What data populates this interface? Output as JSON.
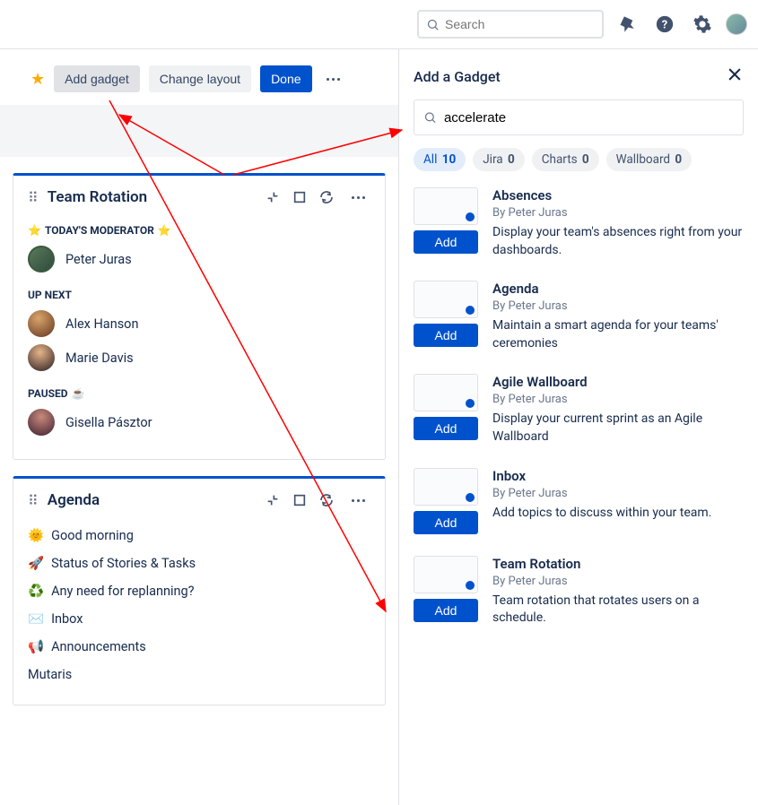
{
  "topbar": {
    "search_placeholder": "Search"
  },
  "toolbar": {
    "add_gadget": "Add gadget",
    "change_layout": "Change layout",
    "done": "Done"
  },
  "card_rotation": {
    "title": "Team Rotation",
    "today_label": "TODAY'S MODERATOR",
    "moderator": "Peter Juras",
    "up_next_label": "UP NEXT",
    "up_next": [
      "Alex Hanson",
      "Marie Davis"
    ],
    "paused_label": "PAUSED",
    "paused": [
      "Gisella Pásztor"
    ]
  },
  "card_agenda": {
    "title": "Agenda",
    "items": [
      {
        "emoji": "🌞",
        "text": "Good morning"
      },
      {
        "emoji": "🚀",
        "text": "Status of Stories & Tasks"
      },
      {
        "emoji": "♻️",
        "text": "Any need for replanning?"
      },
      {
        "emoji": "✉️",
        "text": "Inbox"
      },
      {
        "emoji": "📢",
        "text": "Announcements"
      },
      {
        "emoji": "",
        "text": "Mutaris"
      }
    ]
  },
  "panel": {
    "title": "Add a Gadget",
    "search_value": "accelerate",
    "tabs": [
      {
        "label": "All",
        "count": "10"
      },
      {
        "label": "Jira",
        "count": "0"
      },
      {
        "label": "Charts",
        "count": "0"
      },
      {
        "label": "Wallboard",
        "count": "0"
      }
    ],
    "add_label": "Add",
    "gadgets": [
      {
        "title": "Absences",
        "author": "By Peter Juras",
        "desc": "Display your team's absences right from your dashboards."
      },
      {
        "title": "Agenda",
        "author": "By Peter Juras",
        "desc": "Maintain a smart agenda for your teams' ceremonies"
      },
      {
        "title": "Agile Wallboard",
        "author": "By Peter Juras",
        "desc": "Display your current sprint as an Agile Wallboard"
      },
      {
        "title": "Inbox",
        "author": "By Peter Juras",
        "desc": "Add topics to discuss within your team."
      },
      {
        "title": "Team Rotation",
        "author": "By Peter Juras",
        "desc": "Team rotation that rotates users on a schedule."
      }
    ]
  }
}
